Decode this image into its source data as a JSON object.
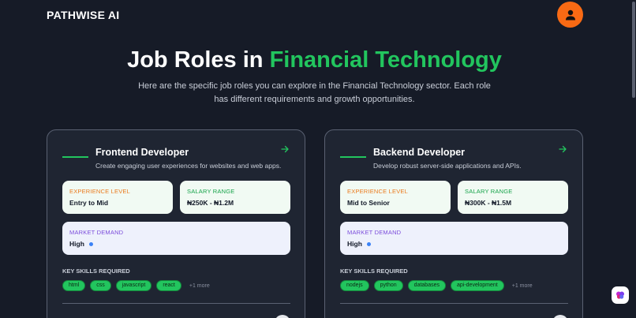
{
  "header": {
    "brand": "PATHWISE AI",
    "avatar_icon": "user-icon",
    "avatar_color": "#f86a14"
  },
  "hero": {
    "title_part1": "Job Roles in ",
    "title_accent": "Financial Technology",
    "accent_color": "#22c55e",
    "subtitle": "Here are the specific job roles you can explore in the Financial Technology sector. Each role has different requirements and growth opportunities."
  },
  "labels": {
    "experience": "EXPERIENCE LEVEL",
    "salary": "SALARY RANGE",
    "demand": "MARKET DEMAND",
    "skills": "KEY SKILLS REQUIRED"
  },
  "cards": [
    {
      "title": "Frontend Developer",
      "description": "Create engaging user experiences for websites and web apps.",
      "experience": "Entry to Mid",
      "salary": "₦250K - ₦1.2M",
      "demand": "High",
      "skills": [
        "html",
        "css",
        "javascript",
        "react"
      ],
      "more": "+1 more"
    },
    {
      "title": "Backend Developer",
      "description": "Develop robust server-side applications and APIs.",
      "experience": "Mid to Senior",
      "salary": "₦300K - ₦1.5M",
      "demand": "High",
      "skills": [
        "nodejs",
        "python",
        "databases",
        "api-development"
      ],
      "more": "+1 more"
    }
  ]
}
